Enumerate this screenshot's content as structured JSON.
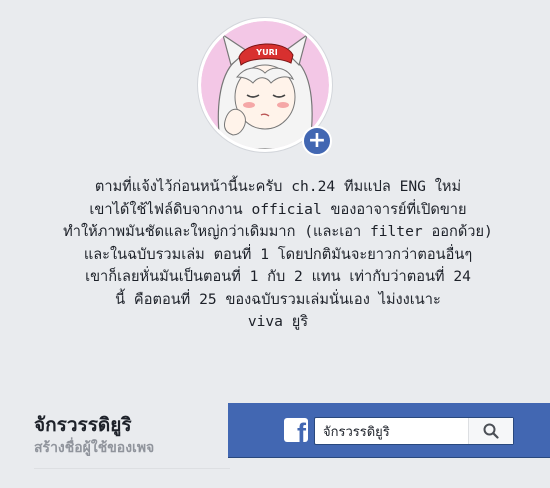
{
  "profile": {
    "avatar_label": "profile picture",
    "hat_text": "YURI",
    "add_button_symbol": "+",
    "add_icon": "plus-icon"
  },
  "post": {
    "text": "ตามที่แจ้งไว้ก่อนหน้านี้นะครับ ch.24 ทีมแปล ENG ใหม่\nเขาได้ใช้ไฟล์ดิบจากงาน official ของอาจารย์ที่เปิดขาย\nทำให้ภาพมันชัดและใหญ่กว่าเดิมมาก (และเอา filter ออกด้วย)\nและในฉบับรวมเล่ม ตอนที่ 1 โดยปกติมันจะยาวกว่าตอนอื่นๆ\nเขาก็เลยหั่นมันเป็นตอนที่ 1 กับ 2 แทน เท่ากับว่าตอนที่ 24\nนี้ คือตอนที่ 25 ของฉบับรวมเล่มนั่นเอง ไม่งงเนาะ\nviva ยูริ"
  },
  "page_info": {
    "name": "จักรวรรดิยูริ",
    "create_username_link": "สร้างชื่อผู้ใช้ของเพจ"
  },
  "top_bar": {
    "logo_letter": "f",
    "logo_icon": "facebook-logo-icon",
    "search_value": "จักรวรรดิยูริ",
    "search_icon": "search-icon"
  },
  "colors": {
    "background": "#e9ebee",
    "facebook_blue": "#4267b2",
    "text": "#1d2129",
    "muted": "#90949c"
  }
}
